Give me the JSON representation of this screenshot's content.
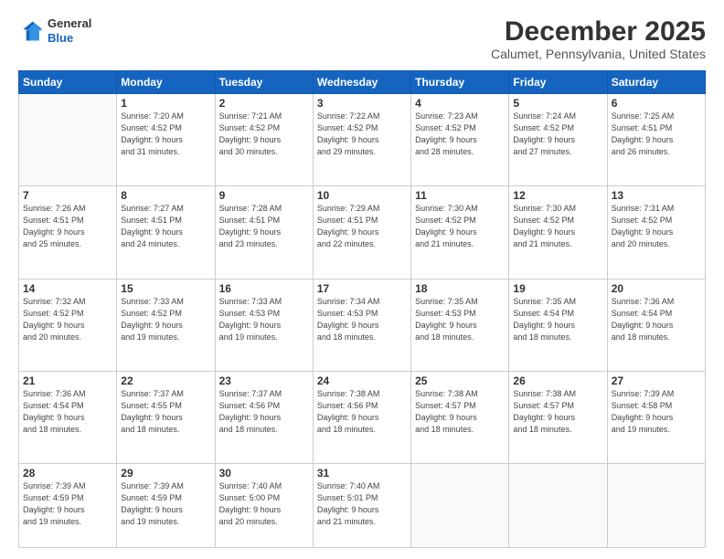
{
  "logo": {
    "line1": "General",
    "line2": "Blue"
  },
  "title": "December 2025",
  "location": "Calumet, Pennsylvania, United States",
  "days_header": [
    "Sunday",
    "Monday",
    "Tuesday",
    "Wednesday",
    "Thursday",
    "Friday",
    "Saturday"
  ],
  "weeks": [
    [
      {
        "day": "",
        "info": ""
      },
      {
        "day": "1",
        "info": "Sunrise: 7:20 AM\nSunset: 4:52 PM\nDaylight: 9 hours\nand 31 minutes."
      },
      {
        "day": "2",
        "info": "Sunrise: 7:21 AM\nSunset: 4:52 PM\nDaylight: 9 hours\nand 30 minutes."
      },
      {
        "day": "3",
        "info": "Sunrise: 7:22 AM\nSunset: 4:52 PM\nDaylight: 9 hours\nand 29 minutes."
      },
      {
        "day": "4",
        "info": "Sunrise: 7:23 AM\nSunset: 4:52 PM\nDaylight: 9 hours\nand 28 minutes."
      },
      {
        "day": "5",
        "info": "Sunrise: 7:24 AM\nSunset: 4:52 PM\nDaylight: 9 hours\nand 27 minutes."
      },
      {
        "day": "6",
        "info": "Sunrise: 7:25 AM\nSunset: 4:51 PM\nDaylight: 9 hours\nand 26 minutes."
      }
    ],
    [
      {
        "day": "7",
        "info": "Sunrise: 7:26 AM\nSunset: 4:51 PM\nDaylight: 9 hours\nand 25 minutes."
      },
      {
        "day": "8",
        "info": "Sunrise: 7:27 AM\nSunset: 4:51 PM\nDaylight: 9 hours\nand 24 minutes."
      },
      {
        "day": "9",
        "info": "Sunrise: 7:28 AM\nSunset: 4:51 PM\nDaylight: 9 hours\nand 23 minutes."
      },
      {
        "day": "10",
        "info": "Sunrise: 7:29 AM\nSunset: 4:51 PM\nDaylight: 9 hours\nand 22 minutes."
      },
      {
        "day": "11",
        "info": "Sunrise: 7:30 AM\nSunset: 4:52 PM\nDaylight: 9 hours\nand 21 minutes."
      },
      {
        "day": "12",
        "info": "Sunrise: 7:30 AM\nSunset: 4:52 PM\nDaylight: 9 hours\nand 21 minutes."
      },
      {
        "day": "13",
        "info": "Sunrise: 7:31 AM\nSunset: 4:52 PM\nDaylight: 9 hours\nand 20 minutes."
      }
    ],
    [
      {
        "day": "14",
        "info": "Sunrise: 7:32 AM\nSunset: 4:52 PM\nDaylight: 9 hours\nand 20 minutes."
      },
      {
        "day": "15",
        "info": "Sunrise: 7:33 AM\nSunset: 4:52 PM\nDaylight: 9 hours\nand 19 minutes."
      },
      {
        "day": "16",
        "info": "Sunrise: 7:33 AM\nSunset: 4:53 PM\nDaylight: 9 hours\nand 19 minutes."
      },
      {
        "day": "17",
        "info": "Sunrise: 7:34 AM\nSunset: 4:53 PM\nDaylight: 9 hours\nand 18 minutes."
      },
      {
        "day": "18",
        "info": "Sunrise: 7:35 AM\nSunset: 4:53 PM\nDaylight: 9 hours\nand 18 minutes."
      },
      {
        "day": "19",
        "info": "Sunrise: 7:35 AM\nSunset: 4:54 PM\nDaylight: 9 hours\nand 18 minutes."
      },
      {
        "day": "20",
        "info": "Sunrise: 7:36 AM\nSunset: 4:54 PM\nDaylight: 9 hours\nand 18 minutes."
      }
    ],
    [
      {
        "day": "21",
        "info": "Sunrise: 7:36 AM\nSunset: 4:54 PM\nDaylight: 9 hours\nand 18 minutes."
      },
      {
        "day": "22",
        "info": "Sunrise: 7:37 AM\nSunset: 4:55 PM\nDaylight: 9 hours\nand 18 minutes."
      },
      {
        "day": "23",
        "info": "Sunrise: 7:37 AM\nSunset: 4:56 PM\nDaylight: 9 hours\nand 18 minutes."
      },
      {
        "day": "24",
        "info": "Sunrise: 7:38 AM\nSunset: 4:56 PM\nDaylight: 9 hours\nand 18 minutes."
      },
      {
        "day": "25",
        "info": "Sunrise: 7:38 AM\nSunset: 4:57 PM\nDaylight: 9 hours\nand 18 minutes."
      },
      {
        "day": "26",
        "info": "Sunrise: 7:38 AM\nSunset: 4:57 PM\nDaylight: 9 hours\nand 18 minutes."
      },
      {
        "day": "27",
        "info": "Sunrise: 7:39 AM\nSunset: 4:58 PM\nDaylight: 9 hours\nand 19 minutes."
      }
    ],
    [
      {
        "day": "28",
        "info": "Sunrise: 7:39 AM\nSunset: 4:59 PM\nDaylight: 9 hours\nand 19 minutes."
      },
      {
        "day": "29",
        "info": "Sunrise: 7:39 AM\nSunset: 4:59 PM\nDaylight: 9 hours\nand 19 minutes."
      },
      {
        "day": "30",
        "info": "Sunrise: 7:40 AM\nSunset: 5:00 PM\nDaylight: 9 hours\nand 20 minutes."
      },
      {
        "day": "31",
        "info": "Sunrise: 7:40 AM\nSunset: 5:01 PM\nDaylight: 9 hours\nand 21 minutes."
      },
      {
        "day": "",
        "info": ""
      },
      {
        "day": "",
        "info": ""
      },
      {
        "day": "",
        "info": ""
      }
    ]
  ]
}
